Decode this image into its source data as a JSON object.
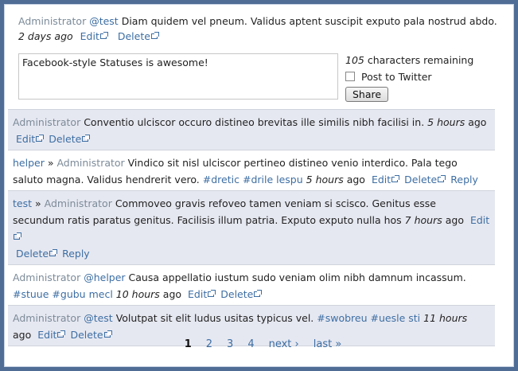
{
  "top_status": {
    "author": "Administrator",
    "mention": "@test",
    "text": " Diam quidem vel pneum. Validus aptent suscipit exputo pala nostrud abdo.",
    "time": "2 days ago",
    "edit": "Edit",
    "delete": "Delete"
  },
  "composer": {
    "value": "Facebook-style Statuses is awesome!",
    "remaining_count": "105",
    "remaining_text": " characters remaining",
    "post_to_twitter": "Post to Twitter",
    "share": "Share"
  },
  "statuses": [
    {
      "author": "Administrator",
      "text": " Conventio ulciscor occuro distineo brevitas ille similis nibh facilisi in. ",
      "time": "5 hours",
      "ago": " ago",
      "edit": "Edit",
      "delete": "Delete"
    },
    {
      "author": "helper",
      "sep": " » ",
      "recipient": "Administrator",
      "text": " Vindico sit nisl ulciscor pertineo distineo venio interdico. Pala tego saluto magna. Validus hendrerit vero. ",
      "tag1": "#dretic",
      "tag2": "#drile lespu",
      "time": "5 hours",
      "ago": " ago",
      "edit": "Edit",
      "delete": "Delete",
      "reply": "Reply"
    },
    {
      "author": "test",
      "sep": " » ",
      "recipient": "Administrator",
      "text": " Commoveo gravis refoveo tamen veniam si scisco. Genitus esse secundum ratis paratus genitus. Facilisis illum patria. Exputo exputo nulla hos ",
      "time": "7 hours",
      "ago": " ago",
      "edit": "Edit",
      "delete": "Delete",
      "reply": "Reply"
    },
    {
      "author": "Administrator",
      "mention": "@helper",
      "text": " Causa appellatio iustum sudo veniam olim nibh damnum incassum. ",
      "tag1": "#stuue",
      "tag2": "#gubu mecl",
      "time": "10 hours",
      "ago": " ago",
      "edit": "Edit",
      "delete": "Delete"
    },
    {
      "author": "Administrator",
      "mention": "@test",
      "text": " Volutpat sit elit ludus usitas typicus vel. ",
      "tag1": "#swobreu",
      "tag2": "#uesle sti",
      "time": "11 hours",
      "ago": "ago",
      "edit": "Edit",
      "delete": "Delete"
    }
  ],
  "pager": {
    "p1": "1",
    "p2": "2",
    "p3": "3",
    "p4": "4",
    "next": "next ›",
    "last": "last »"
  }
}
